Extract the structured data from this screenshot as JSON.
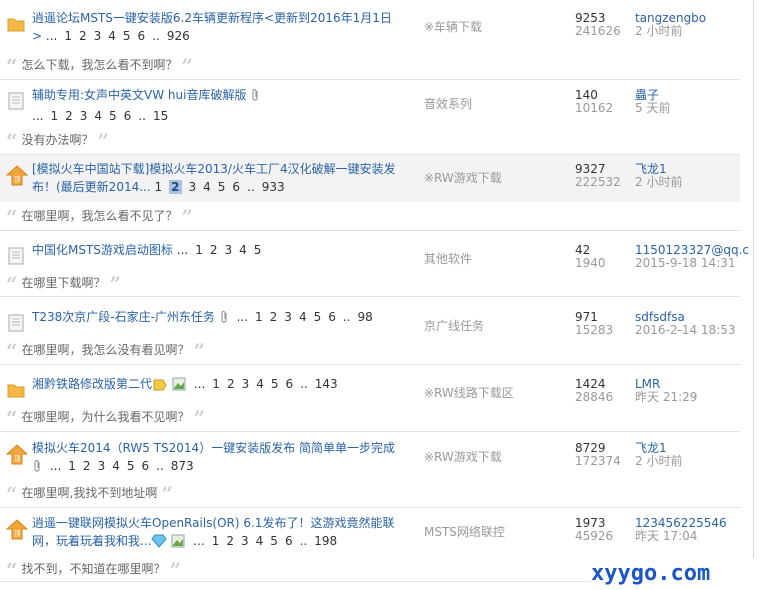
{
  "threads": [
    {
      "icon": "folder-icon",
      "title": "逍遥论坛MSTS一键安装版6.2车辆更新程序<更新到2016年1月1日>",
      "pages_prefix": "...",
      "pages": [
        "1",
        "2",
        "3",
        "4",
        "5",
        "6"
      ],
      "pages_sep": "..",
      "last_page": "926",
      "forum": "※车辆下载",
      "replies": "9253",
      "views": "241626",
      "last_user": "tangzengbo",
      "last_time": "2 小时前",
      "quote": "怎么下载，我怎么看不到啊？"
    },
    {
      "icon": "document-icon",
      "title": "辅助专用:女声中英文VW hui音库破解版",
      "attachment": true,
      "pages_prefix": "...",
      "pages": [
        "1",
        "2",
        "3",
        "4",
        "5",
        "6"
      ],
      "pages_sep": "..",
      "last_page": "15",
      "forum": "音效系列",
      "replies": "140",
      "views": "10162",
      "last_user": "蟲子",
      "last_time": "5 天前",
      "quote": "没有办法啊？"
    },
    {
      "icon": "pinned-icon",
      "title": "[模拟火车中国站下载]模拟火车2013/火车工厂4汉化破解一键安装发布！(最后更新2014...",
      "pages_prefix": "",
      "pages": [
        "1",
        "2",
        "3",
        "4",
        "5",
        "6"
      ],
      "current_page": "2",
      "pages_sep": "..",
      "last_page": "933",
      "forum": "※RW游戏下载",
      "replies": "9327",
      "views": "222532",
      "last_user": "飞龙1",
      "last_time": "2 小时前",
      "quote": "在哪里啊，我怎么看不见了？"
    },
    {
      "icon": "document-icon",
      "title": "中国化MSTS游戏启动图标",
      "pages_prefix": "...",
      "pages": [
        "1",
        "2",
        "3",
        "4",
        "5"
      ],
      "pages_sep": "",
      "last_page": "",
      "forum": "其他软件",
      "replies": "42",
      "views": "1940",
      "last_user": "1150123327@qq.c",
      "last_time": "2015-9-18 14:31",
      "quote": "在哪里下载啊？"
    },
    {
      "icon": "document-icon",
      "title": "T238次京广段-石家庄-广州东任务",
      "attachment": true,
      "pages_prefix": "...",
      "pages": [
        "1",
        "2",
        "3",
        "4",
        "5",
        "6"
      ],
      "pages_sep": "..",
      "last_page": "98",
      "forum": "京广线任务",
      "replies": "971",
      "views": "15283",
      "last_user": "sdfsdfsa",
      "last_time": "2016-2-14 18:53",
      "quote": "在哪里啊，我怎么没有看见啊？"
    },
    {
      "icon": "folder-icon",
      "title": "湘黔铁路修改版第二代",
      "badges": [
        "rating-icon",
        "image-icon"
      ],
      "pages_prefix": "...",
      "pages": [
        "1",
        "2",
        "3",
        "4",
        "5",
        "6"
      ],
      "pages_sep": "..",
      "last_page": "143",
      "forum": "※RW线路下载区",
      "replies": "1424",
      "views": "28846",
      "last_user": "LMR",
      "last_time": "昨天 21:29",
      "quote": "在哪里啊，为什么我看不见啊？"
    },
    {
      "icon": "pinned-icon",
      "title": "模拟火车2014（RW5 TS2014）一键安装版发布 简简单单一步完成",
      "attachment": true,
      "pages_prefix": "...",
      "pages": [
        "1",
        "2",
        "3",
        "4",
        "5",
        "6"
      ],
      "pages_sep": "..",
      "last_page": "873",
      "forum": "※RW游戏下载",
      "replies": "8729",
      "views": "172374",
      "last_user": "飞龙1",
      "last_time": "2 小时前",
      "quote": "在哪里啊,我找不到地址啊"
    },
    {
      "icon": "pinned-icon",
      "title": "逍遥一键联网模拟火车OpenRails(OR) 6.1发布了！这游戏竟然能联网，玩着玩着我和我...",
      "badges": [
        "diamond-icon",
        "image-icon"
      ],
      "pages_prefix": "...",
      "pages": [
        "1",
        "2",
        "3",
        "4",
        "5",
        "6"
      ],
      "pages_sep": "..",
      "last_page": "198",
      "forum": "MSTS网络联控",
      "replies": "1973",
      "views": "45926",
      "last_user": "123456225546",
      "last_time": "昨天 17:04",
      "quote": "找不到，不知道在哪里啊？"
    }
  ],
  "watermark": "xyygo.com",
  "colors": {
    "link": "#2a63a8",
    "muted": "#999999",
    "sticky_bg": "#f3f3f3",
    "watermark": "#1a56c8"
  }
}
